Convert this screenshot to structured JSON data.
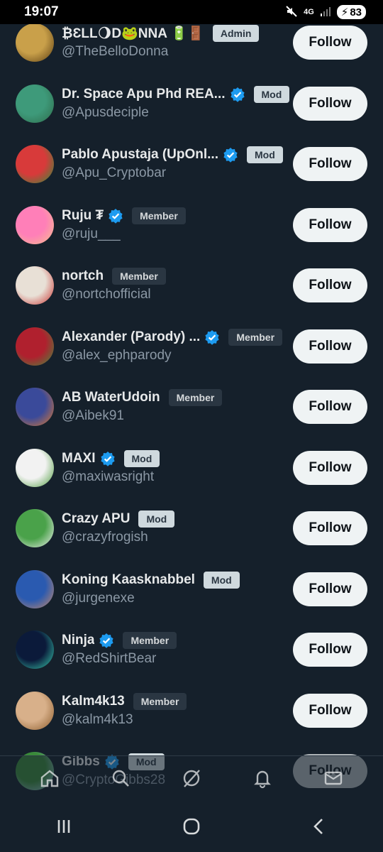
{
  "status_bar": {
    "time": "19:07",
    "network": "4G",
    "battery": "83"
  },
  "members": [
    {
      "name": "₿ƐLL🌖D🐸NNA 🔋🚪",
      "handle": "@TheBelloDonna",
      "verified": false,
      "badge": "Admin",
      "badge_style": "light",
      "follow": "Follow",
      "avatar_colors": [
        "#c9a04a",
        "#5a3d12"
      ]
    },
    {
      "name": "Dr. Space Apu Phd REA...",
      "handle": "@Apusdeciple",
      "verified": true,
      "badge": "Mod",
      "badge_style": "light",
      "follow": "Follow",
      "avatar_colors": [
        "#3e9a7a",
        "#2e6b4a"
      ]
    },
    {
      "name": "Pablo Apustaja (UpOnl...",
      "handle": "@Apu_Cryptobar",
      "verified": true,
      "badge": "Mod",
      "badge_style": "light",
      "follow": "Follow",
      "avatar_colors": [
        "#d83a3a",
        "#2f8f3a"
      ]
    },
    {
      "name": "Ruju ₮",
      "handle": "@ruju___",
      "verified": true,
      "badge": "Member",
      "badge_style": "dark",
      "follow": "Follow",
      "avatar_colors": [
        "#ff7fb8",
        "#f4c28a"
      ]
    },
    {
      "name": "nortch",
      "handle": "@nortchofficial",
      "verified": false,
      "badge": "Member",
      "badge_style": "dark",
      "follow": "Follow",
      "avatar_colors": [
        "#e8e0d6",
        "#c8302e"
      ]
    },
    {
      "name": "Alexander (Parody) ...",
      "handle": "@alex_ephparody",
      "verified": true,
      "badge": "Member",
      "badge_style": "dark",
      "follow": "Follow",
      "avatar_colors": [
        "#b0202e",
        "#3e8e3e"
      ]
    },
    {
      "name": "AB WaterUdoin",
      "handle": "@Aibek91",
      "verified": false,
      "badge": "Member",
      "badge_style": "dark",
      "follow": "Follow",
      "avatar_colors": [
        "#3a4a9a",
        "#e27a2a"
      ]
    },
    {
      "name": "MAXI",
      "handle": "@maxiwasright",
      "verified": true,
      "badge": "Mod",
      "badge_style": "light",
      "follow": "Follow",
      "avatar_colors": [
        "#f2f2f2",
        "#4a9a3a"
      ]
    },
    {
      "name": "Crazy APU",
      "handle": "@crazyfrogish",
      "verified": false,
      "badge": "Mod",
      "badge_style": "light",
      "follow": "Follow",
      "avatar_colors": [
        "#4aa24a",
        "#f2f2f2"
      ]
    },
    {
      "name": "Koning Kaasknabbel",
      "handle": "@jurgenexe",
      "verified": false,
      "badge": "Mod",
      "badge_style": "light",
      "follow": "Follow",
      "avatar_colors": [
        "#2a5ab0",
        "#c88a6a"
      ]
    },
    {
      "name": "Ninja",
      "handle": "@RedShirtBear",
      "verified": true,
      "badge": "Member",
      "badge_style": "dark",
      "follow": "Follow",
      "avatar_colors": [
        "#0b1a3a",
        "#3ad0b0"
      ]
    },
    {
      "name": "Kalm4k13",
      "handle": "@kalm4k13",
      "verified": false,
      "badge": "Member",
      "badge_style": "dark",
      "follow": "Follow",
      "avatar_colors": [
        "#d8b08a",
        "#8a5a2a"
      ]
    },
    {
      "name": "Gibbs",
      "handle": "@CryptoGibbs28",
      "verified": true,
      "badge": "Mod",
      "badge_style": "light",
      "follow": "Follow",
      "avatar_colors": [
        "#3a8a3a",
        "#a0c8e0"
      ]
    }
  ],
  "tabs": [
    "home-icon",
    "search-icon",
    "grok-icon",
    "notifications-icon",
    "messages-icon"
  ],
  "nav": [
    "recents-icon",
    "home-nav-icon",
    "back-icon"
  ],
  "colors": {
    "background": "#15202b",
    "verified": "#1d9bf0",
    "follow_bg": "#eff3f4",
    "handle": "#8b98a5"
  }
}
